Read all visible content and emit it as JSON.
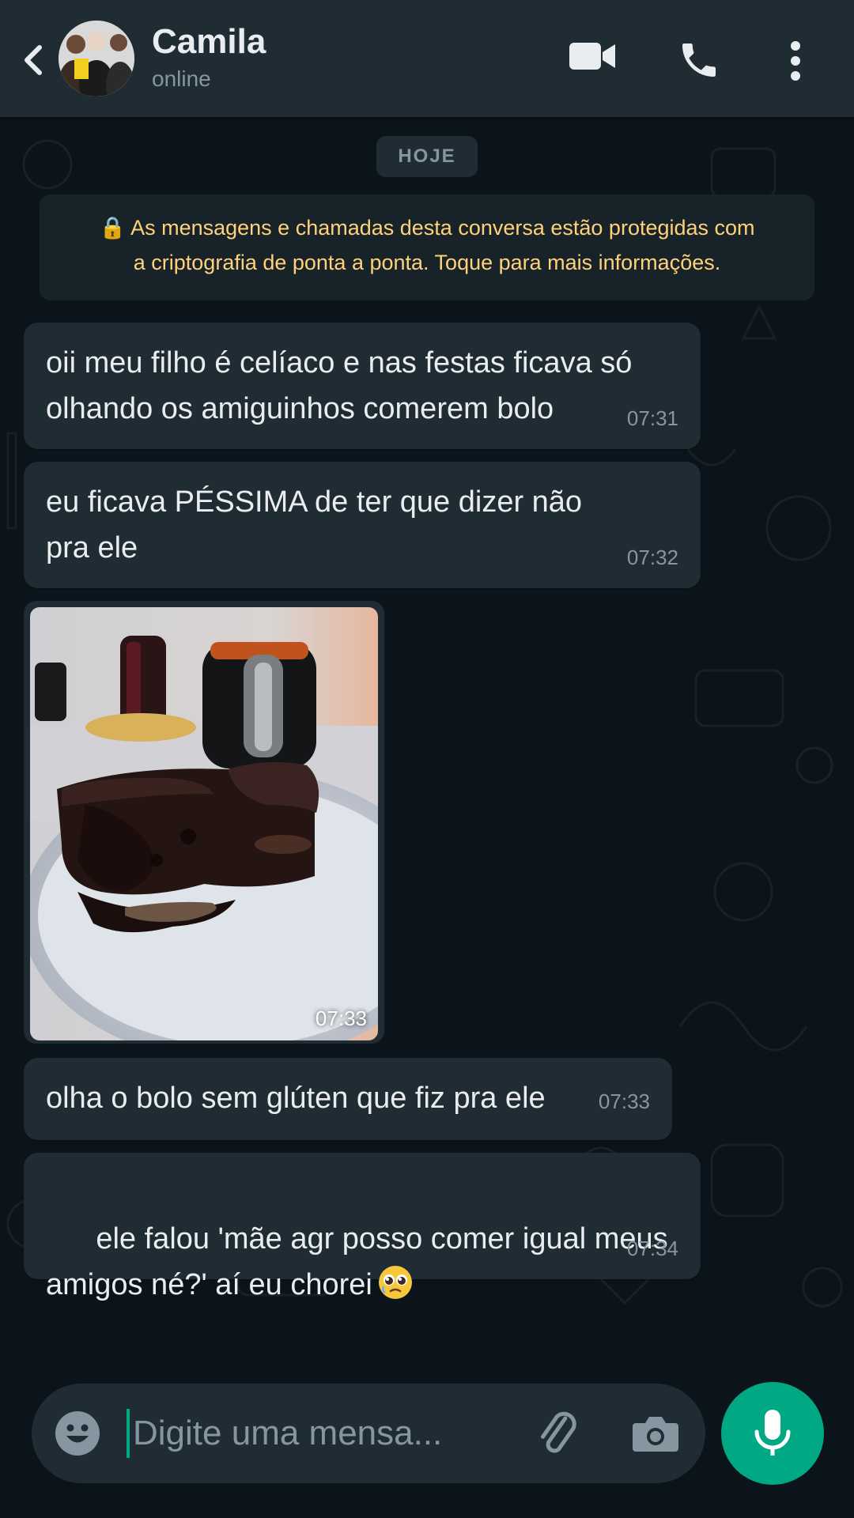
{
  "header": {
    "back_icon": "chevron-left-icon",
    "contact_name": "Camila",
    "status": "online",
    "video_icon": "video-camera-icon",
    "call_icon": "phone-icon",
    "menu_icon": "more-vertical-icon"
  },
  "chat": {
    "day_label": "HOJE",
    "encryption_notice": "🔒 As mensagens e chamadas desta conversa estão protegidas com a criptografia de ponta a ponta. Toque para mais informações.",
    "encryption_line1": "🔒 As mensagens e chamadas desta conversa estão protegidas com",
    "encryption_line2": "a criptografia de ponta a ponta. Toque para mais informações.",
    "messages": [
      {
        "text": "oii meu filho é celíaco e nas festas ficava só\nolhando os amiguinhos comerem bolo",
        "time": "07:31"
      },
      {
        "text": "eu ficava PÉSSIMA de ter que dizer não\npra ele",
        "time": "07:32"
      },
      {
        "type": "image",
        "image_description_icon": "chocolate-cake-photo",
        "time": "07:33"
      },
      {
        "text": "olha o bolo sem glúten que fiz pra ele",
        "time": "07:33"
      },
      {
        "text": "ele falou 'mãe agr posso comer igual meus\namigos né?' aí eu chorei",
        "emoji": "pleading-face-emoji",
        "time": "07:34"
      }
    ]
  },
  "composer": {
    "placeholder": "Digite uma mensa...",
    "emoji_icon": "smiley-icon",
    "attach_icon": "paperclip-icon",
    "camera_icon": "camera-icon",
    "mic_icon": "microphone-icon"
  },
  "colors": {
    "header_bg": "#1f2c34",
    "chat_bg": "#0b141a",
    "bubble_bg": "#202c33",
    "accent": "#00a884",
    "notice_text": "#ffd279",
    "time_text": "#8696a0"
  }
}
